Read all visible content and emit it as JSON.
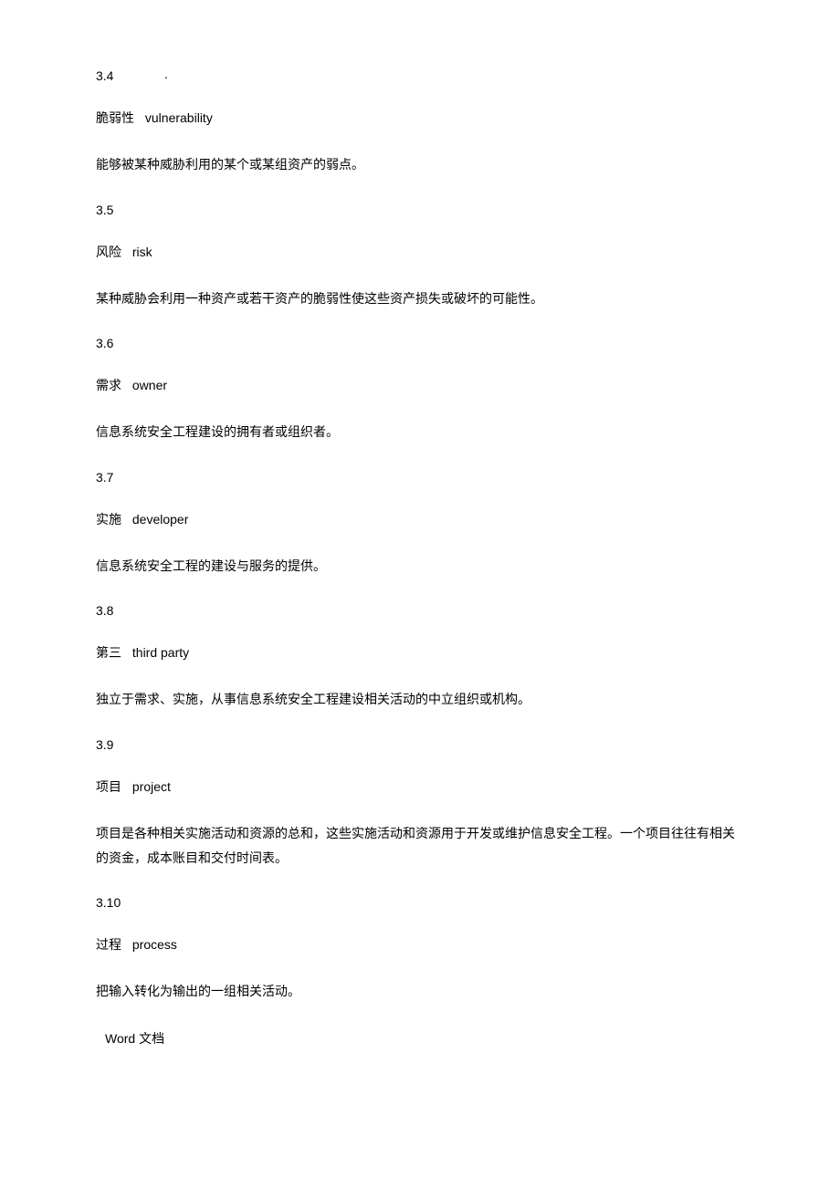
{
  "dot": ".",
  "entries": [
    {
      "num": "3.4",
      "term_cn": "脆弱性",
      "term_en": "vulnerability",
      "def": "能够被某种威胁利用的某个或某组资产的弱点。"
    },
    {
      "num": "3.5",
      "term_cn": "风险",
      "term_en": "risk",
      "def": "某种威胁会利用一种资产或若干资产的脆弱性使这些资产损失或破坏的可能性。"
    },
    {
      "num": "3.6",
      "term_cn": "需求",
      "term_en": "owner",
      "def": "信息系统安全工程建设的拥有者或组织者。"
    },
    {
      "num": "3.7",
      "term_cn": "实施",
      "term_en": "developer",
      "def": "信息系统安全工程的建设与服务的提供。"
    },
    {
      "num": "3.8",
      "term_cn": "第三",
      "term_en": "third party",
      "def": "独立于需求、实施，从事信息系统安全工程建设相关活动的中立组织或机构。"
    },
    {
      "num": "3.9",
      "term_cn": "项目",
      "term_en": "project",
      "def": "项目是各种相关实施活动和资源的总和，这些实施活动和资源用于开发或维护信息安全工程。一个项目往往有相关的资金，成本账目和交付时间表。"
    },
    {
      "num": "3.10",
      "term_cn": "过程",
      "term_en": "process",
      "def": "把输入转化为输出的一组相关活动。"
    }
  ],
  "footer": "Word 文档"
}
